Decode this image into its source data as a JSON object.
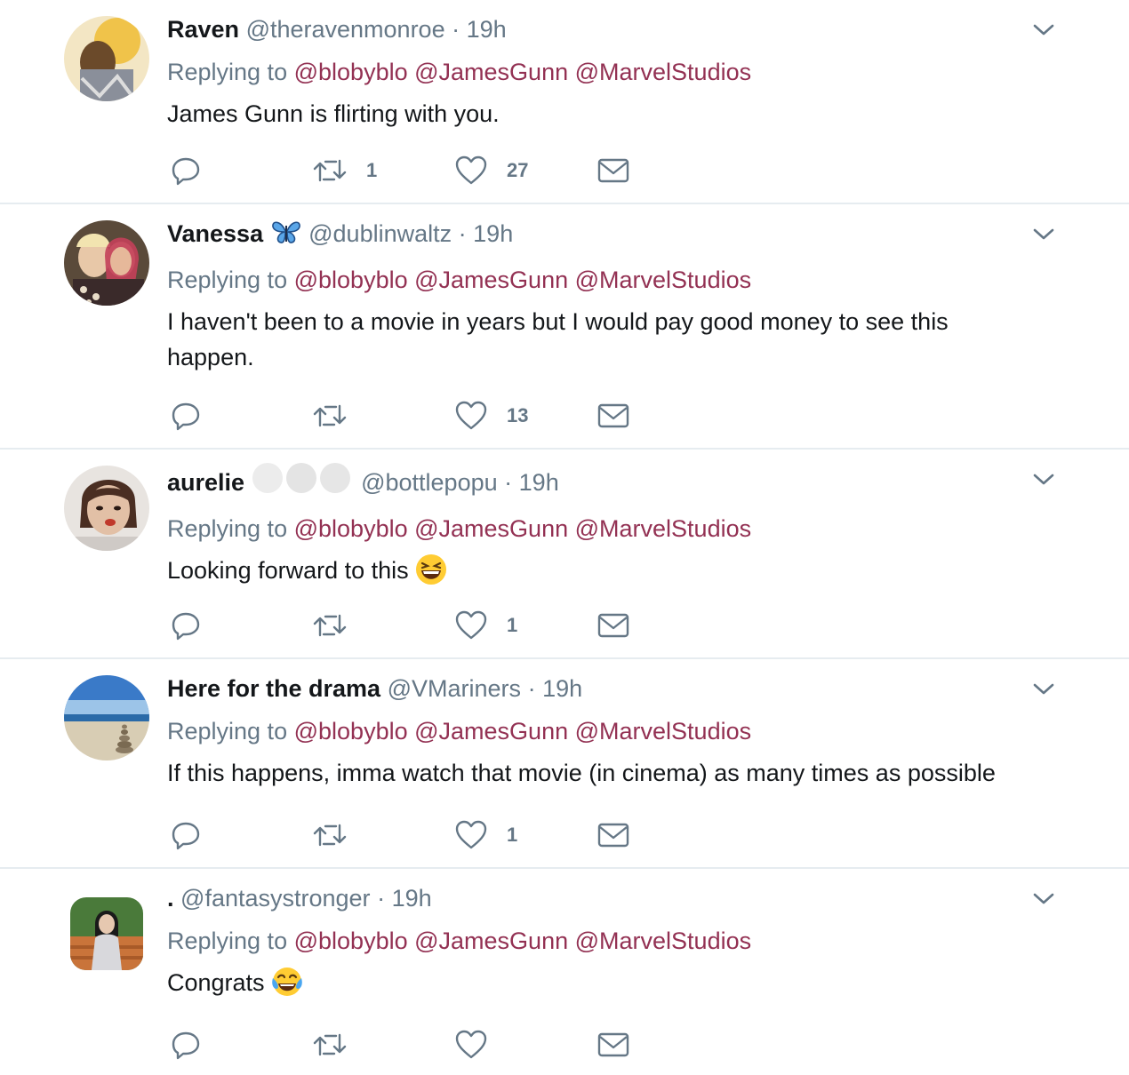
{
  "tweets": [
    {
      "name": "Raven",
      "handle": "@theravenmonroe",
      "separator": "·",
      "time": "19h",
      "replying_prefix": "Replying to",
      "mentions": [
        "@blobyblo",
        "@JamesGunn",
        "@MarvelStudios"
      ],
      "text": "James Gunn is flirting with you.",
      "retweets": "1",
      "likes": "27",
      "avatar_colors": [
        "#f0c34a",
        "#c99a3a"
      ]
    },
    {
      "name": "Vanessa",
      "handle": "@dublinwaltz",
      "separator": "·",
      "time": "19h",
      "replying_prefix": "Replying to",
      "mentions": [
        "@blobyblo",
        "@JamesGunn",
        "@MarvelStudios"
      ],
      "text": "I haven't been to a movie in years but I would pay good money to see this happen.",
      "retweets": "",
      "likes": "13",
      "avatar_colors": [
        "#c3405a",
        "#3a2a2a"
      ]
    },
    {
      "name": "aurelie",
      "handle": "@bottlepopu",
      "separator": "·",
      "time": "19h",
      "replying_prefix": "Replying to",
      "mentions": [
        "@blobyblo",
        "@JamesGunn",
        "@MarvelStudios"
      ],
      "text": "Looking forward to this",
      "retweets": "",
      "likes": "1",
      "avatar_colors": [
        "#d9b8a8",
        "#5a3a2a"
      ]
    },
    {
      "name": "Here for the drama",
      "handle": "@VMariners",
      "separator": "·",
      "time": "19h",
      "replying_prefix": "Replying to",
      "mentions": [
        "@blobyblo",
        "@JamesGunn",
        "@MarvelStudios"
      ],
      "text": "If this happens, imma watch that movie (in cinema) as many times as possible",
      "retweets": "",
      "likes": "1",
      "avatar_colors": [
        "#3a6fb8",
        "#d8c9a8"
      ]
    },
    {
      "name": ".",
      "handle": "@fantasystronger",
      "separator": "·",
      "time": "19h",
      "replying_prefix": "Replying to",
      "mentions": [
        "@blobyblo",
        "@JamesGunn",
        "@MarvelStudios"
      ],
      "text": "Congrats",
      "retweets": "",
      "likes": "",
      "avatar_colors": [
        "#4a7a3a",
        "#c9743a"
      ]
    }
  ],
  "icons": {
    "reply": "reply-icon",
    "retweet": "retweet-icon",
    "like": "heart-icon",
    "dm": "envelope-icon",
    "caret": "chevron-down-icon"
  },
  "colors": {
    "mention": "#933153",
    "secondary_text": "#657786",
    "divider": "#e6ecf0"
  }
}
